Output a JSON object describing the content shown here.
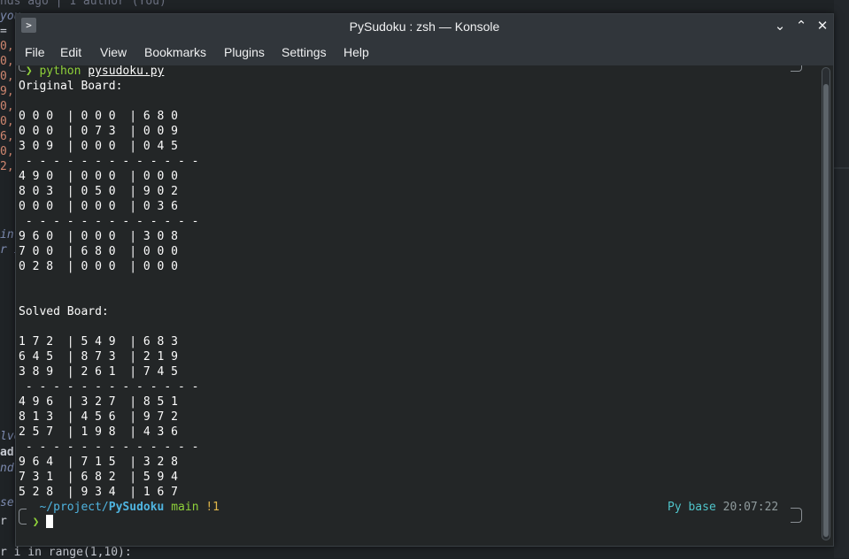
{
  "window": {
    "title": "PySudoku : zsh — Konsole",
    "app_icon": ">",
    "buttons": {
      "minimize": "⌄",
      "maximize": "⌃",
      "close": "✕"
    }
  },
  "menubar": {
    "items": [
      "File",
      "Edit",
      "View",
      "Bookmarks",
      "Plugins",
      "Settings",
      "Help"
    ]
  },
  "terminal": {
    "command": {
      "arrow": "❯",
      "program": "python",
      "file": "pysudoku.py"
    },
    "original_title": "Original Board:",
    "original_board": [
      "0 0 0  | 0 0 0  | 6 8 0",
      "0 0 0  | 0 7 3  | 0 0 9",
      "3 0 9  | 0 0 0  | 0 4 5",
      " - - - - - - - - - - - - -",
      "4 9 0  | 0 0 0  | 0 0 0",
      "8 0 3  | 0 5 0  | 9 0 2",
      "0 0 0  | 0 0 0  | 0 3 6",
      " - - - - - - - - - - - - -",
      "9 6 0  | 0 0 0  | 3 0 8",
      "7 0 0  | 6 8 0  | 0 0 0",
      "0 2 8  | 0 0 0  | 0 0 0"
    ],
    "solved_title": "Solved Board:",
    "solved_board": [
      "1 7 2  | 5 4 9  | 6 8 3",
      "6 4 5  | 8 7 3  | 2 1 9",
      "3 8 9  | 2 6 1  | 7 4 5",
      " - - - - - - - - - - - - -",
      "4 9 6  | 3 2 7  | 8 5 1",
      "8 1 3  | 4 5 6  | 9 7 2",
      "2 5 7  | 1 9 8  | 4 3 6",
      " - - - - - - - - - - - - -",
      "9 6 4  | 7 1 5  | 3 2 8",
      "7 3 1  | 6 8 2  | 5 9 4",
      "5 2 8  | 9 3 4  | 1 6 7"
    ],
    "prompt": {
      "tilde_path": "~/project/",
      "dir": "PySudoku",
      "branch": "main",
      "status": "!1",
      "env": "Py base",
      "time": "20:07:22",
      "arrow": "❯"
    }
  },
  "background_editor": {
    "lines": [
      {
        "text": "nds ago | 1 author (You)",
        "cls": ""
      },
      {
        "text": "you",
        "cls": "kw"
      },
      {
        "text": "= [",
        "cls": "plain"
      },
      {
        "text": "0,",
        "cls": "num"
      },
      {
        "text": "0,",
        "cls": "num"
      },
      {
        "text": "0,",
        "cls": "num"
      },
      {
        "text": "9,",
        "cls": "num"
      },
      {
        "text": "0,",
        "cls": "num"
      },
      {
        "text": "0,",
        "cls": "num"
      },
      {
        "text": "6,",
        "cls": "num"
      },
      {
        "text": "0,",
        "cls": "num"
      },
      {
        "text": "2,",
        "cls": "num"
      },
      {
        "text": "int",
        "cls": "kw"
      },
      {
        "text": "r i",
        "cls": "kw"
      },
      {
        "text": "lve",
        "cls": "kw"
      },
      {
        "text": "ad",
        "cls": "plain"
      },
      {
        "text": "nd",
        "cls": "kw"
      },
      {
        "text": "se:",
        "cls": "kw"
      },
      {
        "text": "r",
        "cls": "plain"
      },
      {
        "text": "r i in range(1,10):",
        "cls": "plain"
      }
    ]
  }
}
